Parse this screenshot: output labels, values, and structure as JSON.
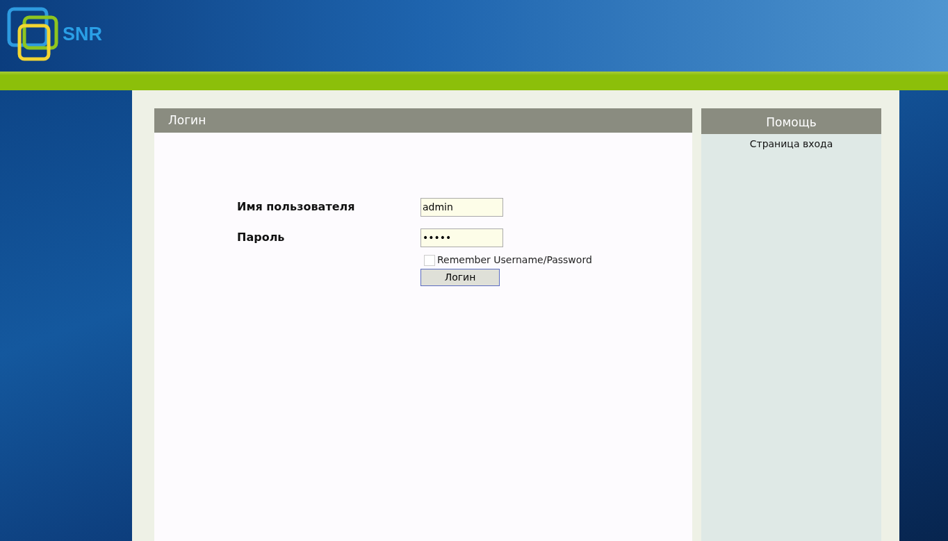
{
  "header": {
    "logo_text": "SNR"
  },
  "login_panel": {
    "title": "Логин",
    "fields": [
      {
        "label": "Имя пользователя",
        "value": "admin"
      },
      {
        "label": "Пароль",
        "value": "•••••"
      }
    ],
    "remember": {
      "label": "Remember Username/Password",
      "checked": false
    },
    "submit": "Логин"
  },
  "help_panel": {
    "title": "Помощь",
    "text": "Страница входа"
  }
}
